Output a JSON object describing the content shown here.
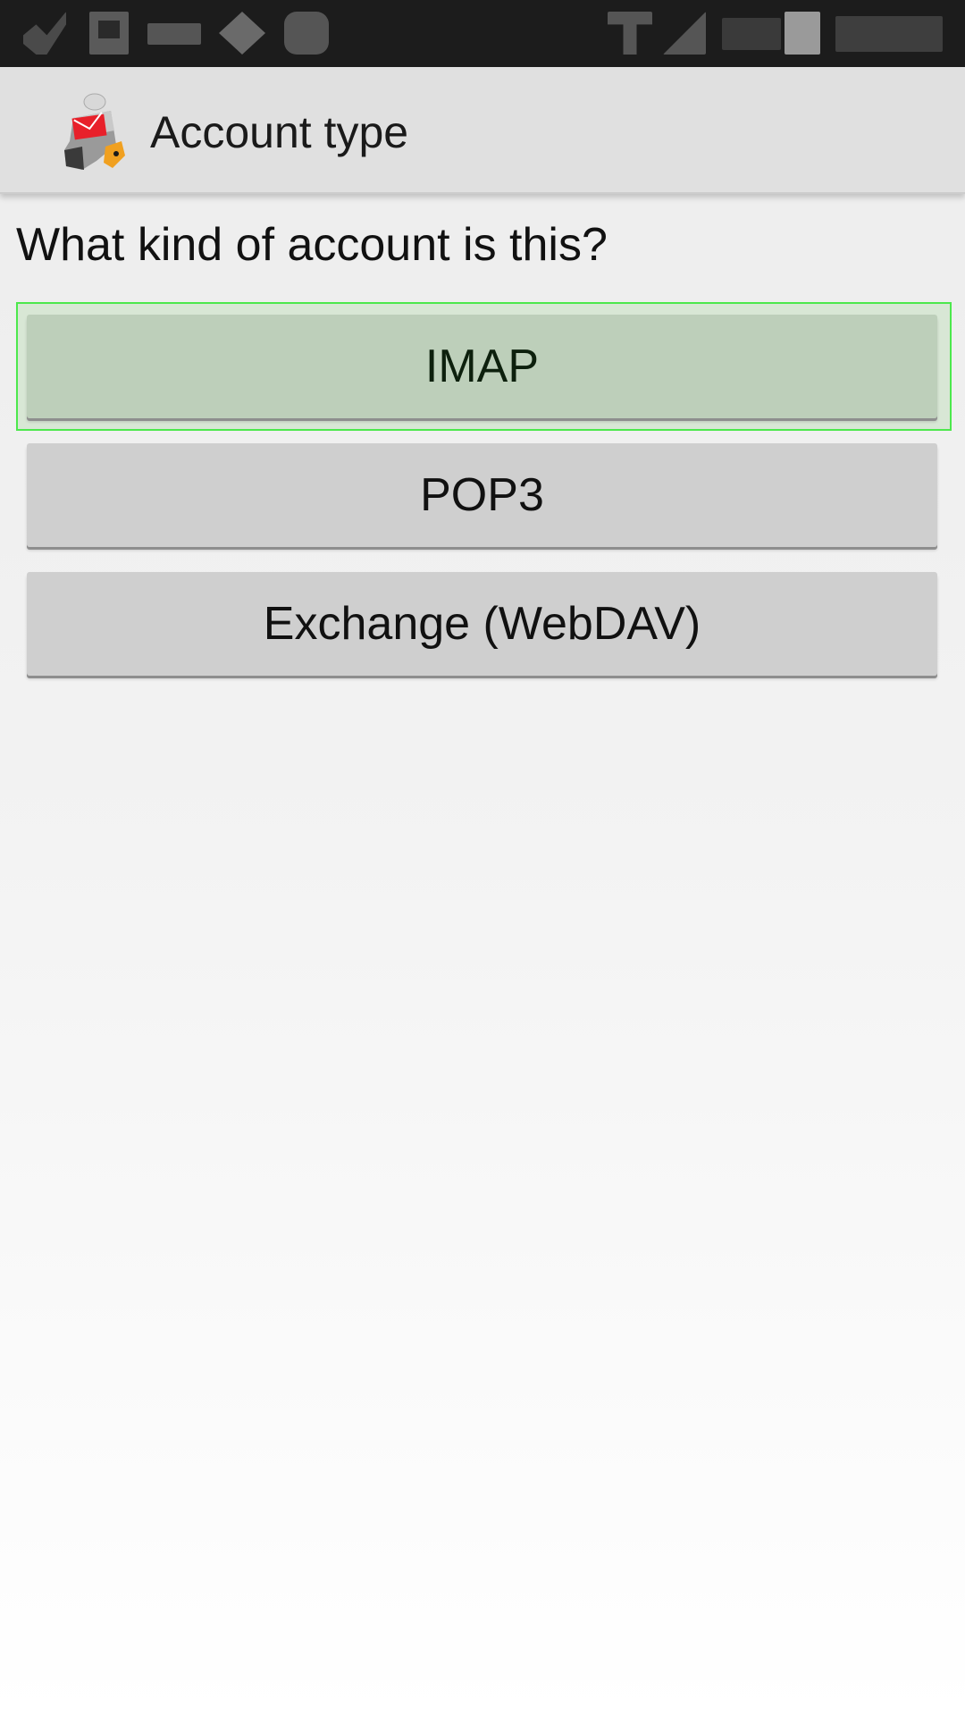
{
  "status_bar": {
    "icons": [
      "notification-icon",
      "gallery-icon",
      "voicemail-icon",
      "settings-icon",
      "android-icon",
      "data-transfer-icon",
      "signal-icon",
      "battery-percent-icon",
      "battery-icon",
      "clock-icon"
    ]
  },
  "action_bar": {
    "title": "Account type",
    "logo_icon": "k9-mail-dog-icon"
  },
  "main": {
    "question": "What kind of account is this?",
    "options": [
      {
        "label": "IMAP",
        "selected": true
      },
      {
        "label": "POP3",
        "selected": false
      },
      {
        "label": "Exchange (WebDAV)",
        "selected": false
      }
    ]
  },
  "colors": {
    "focus_ring": "#4ce84c",
    "selected_button": "#bdcfba",
    "button": "#cfcfcf",
    "action_bar": "#e0e0e0",
    "status_bar": "#1c1c1c"
  }
}
